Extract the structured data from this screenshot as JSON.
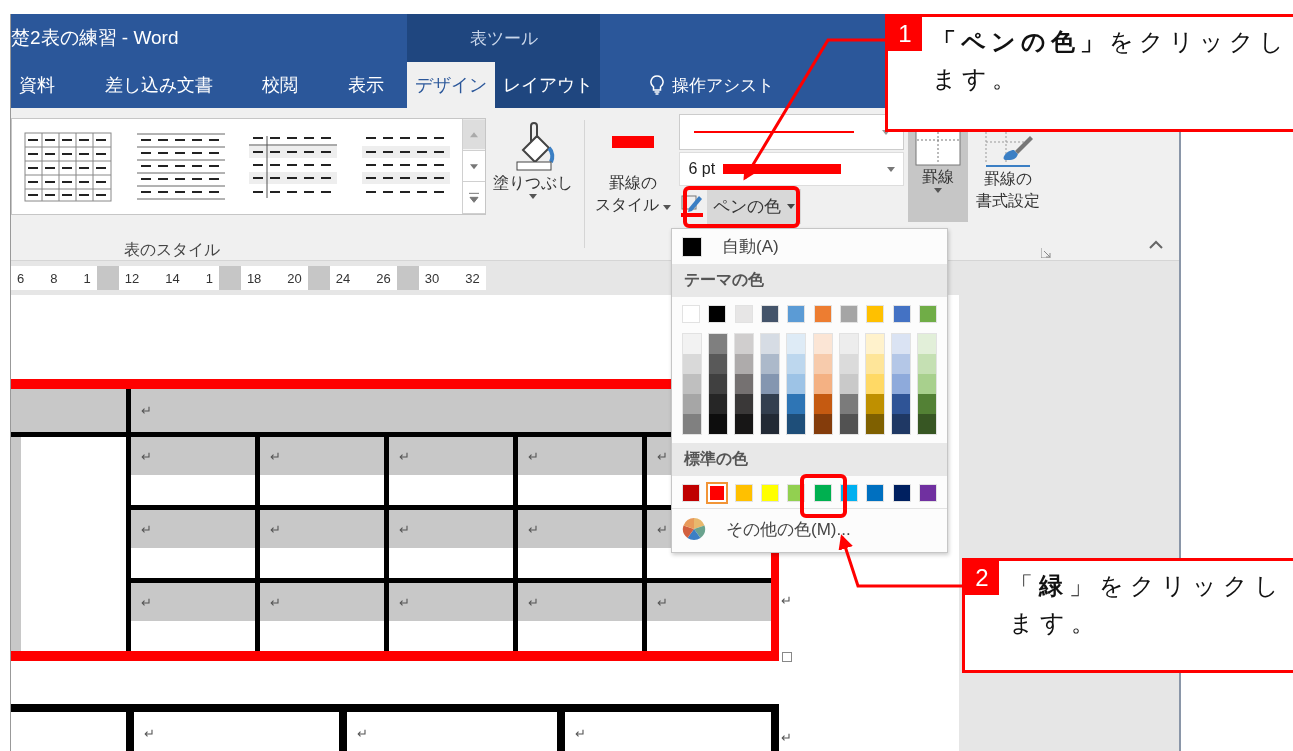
{
  "title_bar": {
    "title": "楚2表の練習 - Word",
    "context_title": "表ツール"
  },
  "tabs": [
    {
      "label": "資料",
      "selected": false,
      "contextual": false
    },
    {
      "label": "差し込み文書",
      "selected": false,
      "contextual": false
    },
    {
      "label": "校閲",
      "selected": false,
      "contextual": false
    },
    {
      "label": "表示",
      "selected": false,
      "contextual": false
    },
    {
      "label": "デザイン",
      "selected": true,
      "contextual": true
    },
    {
      "label": "レイアウト",
      "selected": false,
      "contextual": true
    }
  ],
  "tell_me": {
    "label": "操作アシスト"
  },
  "ribbon": {
    "table_styles": {
      "label": "表のスタイル",
      "shading": "塗りつぶし"
    },
    "borders": {
      "pen_style": [
        "罫線の",
        "スタイル"
      ],
      "pen_weight": "6 pt",
      "pen_color": "ペンの色",
      "borders_button": "罫線",
      "border_painter": [
        "罫線の",
        "書式設定"
      ]
    }
  },
  "ruler": {
    "segments": [
      [
        "6",
        "8",
        "1"
      ],
      [
        "12",
        "14",
        "1"
      ],
      [
        "18",
        "20"
      ],
      [
        "24",
        "26"
      ],
      [
        "30",
        "32"
      ]
    ]
  },
  "pen_color_menu": {
    "automatic": "自動(A)",
    "theme_header": "テーマの色",
    "theme_colors": [
      {
        "color": "#ffffff",
        "shades": [
          {
            "color": "#f2f2f2"
          },
          {
            "color": "#d9d9d9"
          },
          {
            "color": "#bfbfbf"
          },
          {
            "color": "#a6a6a6"
          },
          {
            "color": "#808080"
          }
        ]
      },
      {
        "color": "#000000",
        "shades": [
          {
            "color": "#7f7f7f"
          },
          {
            "color": "#595959"
          },
          {
            "color": "#404040"
          },
          {
            "color": "#262626"
          },
          {
            "color": "#0d0d0d"
          }
        ]
      },
      {
        "color": "#e7e6e6",
        "shades": [
          {
            "color": "#d0cece"
          },
          {
            "color": "#aeabab"
          },
          {
            "color": "#757171"
          },
          {
            "color": "#3a3838"
          },
          {
            "color": "#171616"
          }
        ]
      },
      {
        "color": "#44546a",
        "shades": [
          {
            "color": "#d6dce4"
          },
          {
            "color": "#acb9ca"
          },
          {
            "color": "#8496b0"
          },
          {
            "color": "#333f4f"
          },
          {
            "color": "#222a35"
          }
        ]
      },
      {
        "color": "#5b9bd5",
        "shades": [
          {
            "color": "#deebf6"
          },
          {
            "color": "#bdd7ee"
          },
          {
            "color": "#9dc3e6"
          },
          {
            "color": "#2e75b5"
          },
          {
            "color": "#1e4e79"
          }
        ]
      },
      {
        "color": "#ed7d31",
        "shades": [
          {
            "color": "#fbe5d5"
          },
          {
            "color": "#f7cbac"
          },
          {
            "color": "#f4b183"
          },
          {
            "color": "#c55a11"
          },
          {
            "color": "#843c0b"
          }
        ]
      },
      {
        "color": "#a5a5a5",
        "shades": [
          {
            "color": "#ededed"
          },
          {
            "color": "#dbdbdb"
          },
          {
            "color": "#c9c9c9"
          },
          {
            "color": "#7b7b7b"
          },
          {
            "color": "#525252"
          }
        ]
      },
      {
        "color": "#ffc000",
        "shades": [
          {
            "color": "#fff2cc"
          },
          {
            "color": "#fee599"
          },
          {
            "color": "#ffd965"
          },
          {
            "color": "#bf9000"
          },
          {
            "color": "#7f6000"
          }
        ]
      },
      {
        "color": "#4472c4",
        "shades": [
          {
            "color": "#dae3f3"
          },
          {
            "color": "#b4c7e7"
          },
          {
            "color": "#8eaadb"
          },
          {
            "color": "#2f5496"
          },
          {
            "color": "#1f3864"
          }
        ]
      },
      {
        "color": "#70ad47",
        "shades": [
          {
            "color": "#e2efd9"
          },
          {
            "color": "#c5e0b3"
          },
          {
            "color": "#a8d08d"
          },
          {
            "color": "#538135"
          },
          {
            "color": "#375623"
          }
        ]
      }
    ],
    "standard_header": "標準の色",
    "standard_colors": [
      {
        "color": "#c00000",
        "selected": false
      },
      {
        "color": "#ff0000",
        "selected": true
      },
      {
        "color": "#ffc000",
        "selected": false
      },
      {
        "color": "#ffff00",
        "selected": false
      },
      {
        "color": "#92d050",
        "selected": false
      },
      {
        "color": "#00b050",
        "selected": false
      },
      {
        "color": "#00b0f0",
        "selected": false
      },
      {
        "color": "#0070c0",
        "selected": false
      },
      {
        "color": "#002060",
        "selected": false
      },
      {
        "color": "#7030a0",
        "selected": false
      }
    ],
    "more_colors": "その他の色(M)..."
  },
  "table_1": {
    "header_row": [
      "↵"
    ],
    "rows": [
      [
        "↵",
        "↵",
        "↵",
        "↵",
        "↵"
      ],
      [
        "↵",
        "↵",
        "↵",
        "↵",
        "↵"
      ],
      [
        "↵",
        "↵",
        "↵",
        "↵",
        "↵"
      ]
    ],
    "end_mark": "↵"
  },
  "table_2": {
    "cells": [
      "↵",
      "↵",
      "↵"
    ],
    "end_mark": "↵"
  },
  "callouts": [
    {
      "number": "1",
      "text": "**「ペンの色」**をクリックします。"
    },
    {
      "number": "2",
      "text": "「**緑**」をクリックします。"
    }
  ]
}
